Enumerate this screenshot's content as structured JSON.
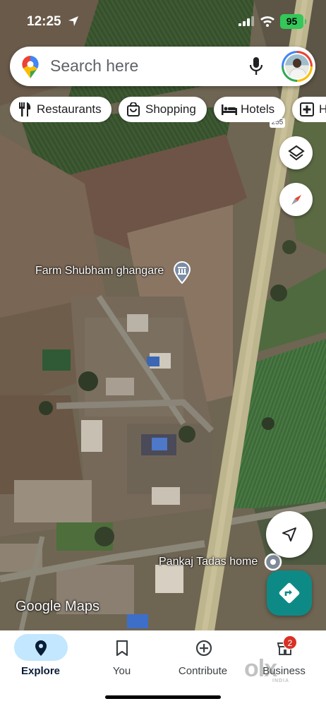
{
  "status_bar": {
    "time": "12:25",
    "battery": "95"
  },
  "search": {
    "placeholder": "Search here"
  },
  "chips": [
    {
      "label": "Restaurants",
      "icon": "fork-knife-icon"
    },
    {
      "label": "Shopping",
      "icon": "shopping-bag-icon"
    },
    {
      "label": "Hotels",
      "icon": "bed-icon"
    },
    {
      "label": "H",
      "icon": "hospital-icon"
    }
  ],
  "map": {
    "route_number": "255",
    "places": [
      {
        "name": "Farm Shubham ghangare",
        "icon": "museum-icon"
      },
      {
        "name": "Pankaj Tadas home",
        "icon": "dot-marker-icon"
      }
    ],
    "watermark": "Google Maps"
  },
  "nav": {
    "items": [
      {
        "label": "Explore",
        "icon": "location-pin-icon",
        "active": true
      },
      {
        "label": "You",
        "icon": "bookmark-icon",
        "active": false
      },
      {
        "label": "Contribute",
        "icon": "add-circle-icon",
        "active": false
      },
      {
        "label": "Business",
        "icon": "store-icon",
        "active": false
      }
    ],
    "business_badge": "2"
  },
  "overlay_watermark": {
    "text": "olx",
    "sub": "INDIA"
  },
  "colors": {
    "accent": "#c2e7ff",
    "directions_button": "#0e8a86",
    "badge": "#d93025",
    "battery": "#34c759"
  }
}
